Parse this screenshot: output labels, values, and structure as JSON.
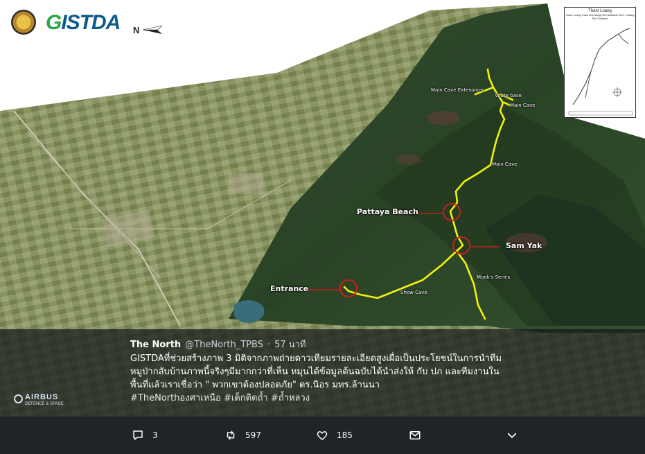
{
  "header": {
    "logo_gistda_text": "GISTDA",
    "north_label": "N"
  },
  "inset_map": {
    "title_line1": "Tham Luang",
    "title_line2": "Tham Luang Cave Doi Nang Non National Park, Chiang Rai Thailand"
  },
  "map_labels": {
    "main_cave_extensions": "Main Cave Extensions",
    "voute_base": "Voute base",
    "main_cave_top": "Main Cave",
    "main_cave_mid": "Main Cave",
    "pattaya_beach": "Pattaya Beach",
    "sam_yak": "Sam Yak",
    "monks_series": "Monk's Series",
    "entrance": "Entrance",
    "show_cave": "Show Cave"
  },
  "watermark": {
    "line1": "AIRBUS",
    "line2": "DEFENCE & SPACE"
  },
  "tweet": {
    "author": "The North",
    "handle": "@TheNorth_TPBS",
    "separator": "·",
    "time": "57 นาที",
    "line1": "GISTDAที่ช่วยสร้างภาพ 3 มิติจากภาพถ่ายดาวเทียมรายละเอียดสูงเผื่อเป็นประโยชน์ในการนำทีม",
    "line2": "หมูป่ากลับบ้านภาพนี้จริงๆมีมากกว่าที่เห็น หมุนได้ข้อมูลต้นฉบับได้นำส่งให้ กับ ปภ และทีมงานใน",
    "line3": "พื้นที่แล้วเราเชื่อว่า \" พวกเขาต้องปลอดภัย\" ดร.นิอร มทร.ล้านนา",
    "hashtags": "#TheNorthองศาเหนือ #เด็กติดถ้ำ #ถ้ำหลวง"
  },
  "actions": {
    "reply_count": "3",
    "retweet_count": "597",
    "like_count": "185"
  },
  "colors": {
    "cave_route": "#f2f20a",
    "marker_red": "#c81e1e",
    "overlay_bg": "#14171a"
  },
  "icons": [
    "gistda-seal",
    "north-arrow-icon",
    "reply-icon",
    "retweet-icon",
    "like-icon",
    "dm-icon",
    "chevron-down-icon"
  ]
}
